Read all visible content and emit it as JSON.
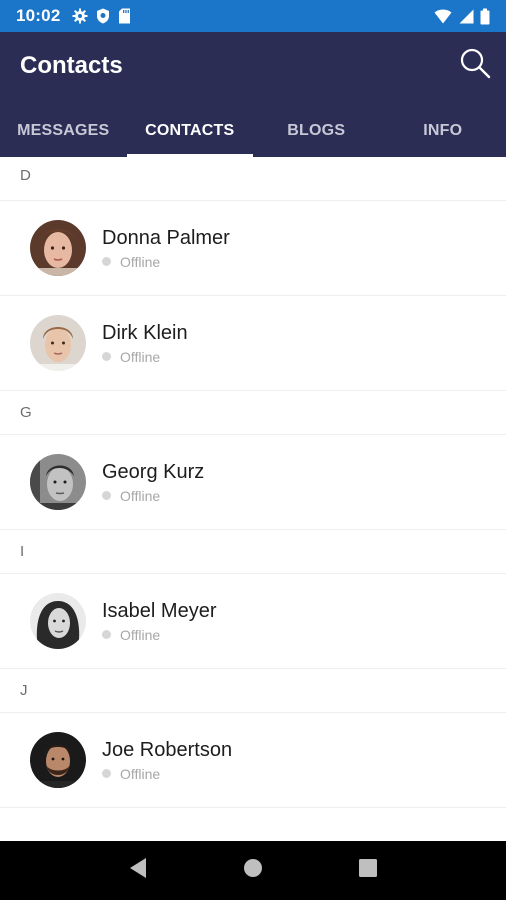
{
  "status_bar": {
    "time": "10:02",
    "icons_left": [
      "gear-icon",
      "shield-icon",
      "sd-card-icon"
    ],
    "icons_right": [
      "wifi-icon",
      "signal-icon",
      "battery-icon"
    ]
  },
  "app_bar": {
    "title": "Contacts",
    "search_icon": "search-icon"
  },
  "tabs": [
    {
      "label": "MESSAGES",
      "active": false
    },
    {
      "label": "CONTACTS",
      "active": true
    },
    {
      "label": "BLOGS",
      "active": false
    },
    {
      "label": "INFO",
      "active": false
    }
  ],
  "sections": [
    {
      "letter": "D",
      "contacts": [
        {
          "name": "Donna Palmer",
          "status": "Offline"
        },
        {
          "name": "Dirk Klein",
          "status": "Offline"
        }
      ]
    },
    {
      "letter": "G",
      "contacts": [
        {
          "name": "Georg Kurz",
          "status": "Offline"
        }
      ]
    },
    {
      "letter": "I",
      "contacts": [
        {
          "name": "Isabel Meyer",
          "status": "Offline"
        }
      ]
    },
    {
      "letter": "J",
      "contacts": [
        {
          "name": "Joe Robertson",
          "status": "Offline"
        }
      ]
    }
  ],
  "nav_bar": {
    "buttons": [
      "back-icon",
      "home-icon",
      "recents-icon"
    ]
  },
  "colors": {
    "status_bar": "#1b76c9",
    "app_bar": "#2b2d55",
    "offline_dot": "#d6d6d6"
  }
}
